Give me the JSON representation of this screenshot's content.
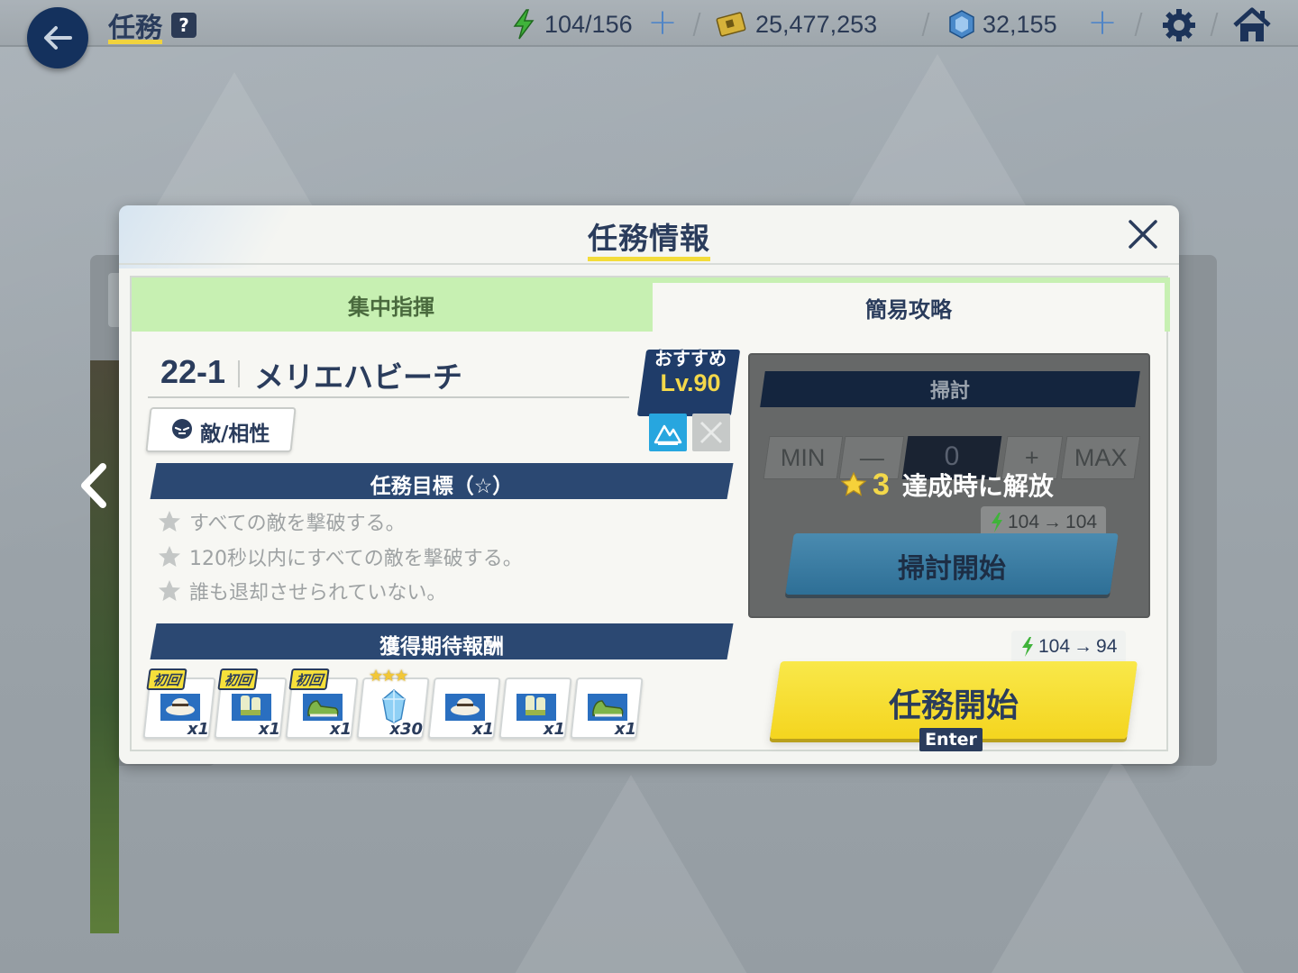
{
  "header": {
    "title": "任務",
    "help_label": "?",
    "stamina": "104/156",
    "credits": "25,477,253",
    "gems": "32,155"
  },
  "dialog": {
    "title": "任務情報",
    "tabs": [
      "集中指揮",
      "簡易攻略"
    ],
    "stage": {
      "code": "22-1",
      "name": "メリエハビーチ",
      "recommended_label": "おすすめ",
      "recommended_level": "Lv.90"
    },
    "enemy_button": "敵/相性",
    "objectives_header": "任務目標（☆）",
    "objectives": [
      "すべての敵を撃破する。",
      "120秒以内にすべての敵を撃破する。",
      "誰も退却させられていない。"
    ],
    "rewards_header": "獲得期待報酬",
    "rewards": [
      {
        "badge": "初回",
        "qty": "x1",
        "icon": "hat-icon"
      },
      {
        "badge": "初回",
        "qty": "x1",
        "icon": "gloves-icon"
      },
      {
        "badge": "初回",
        "qty": "x1",
        "icon": "shoes-icon"
      },
      {
        "badge": "★★★",
        "qty": "x30",
        "icon": "crystal-icon"
      },
      {
        "badge": "",
        "qty": "x1",
        "icon": "hat-icon"
      },
      {
        "badge": "",
        "qty": "x1",
        "icon": "gloves-icon"
      },
      {
        "badge": "",
        "qty": "x1",
        "icon": "shoes-icon"
      }
    ],
    "sweep": {
      "header": "掃討",
      "min_label": "MIN",
      "minus_label": "—",
      "count": "0",
      "plus_label": "+",
      "max_label": "MAX",
      "unlock_star_count": "3",
      "unlock_text": "達成時に解放",
      "cost_from": "104",
      "cost_to": "104",
      "start_label": "掃討開始"
    },
    "mission": {
      "cost_from": "104",
      "cost_to": "94",
      "start_label": "任務開始",
      "hotkey": "Enter"
    }
  },
  "colors": {
    "navy": "#2a3c5c",
    "accent_yellow": "#f4d51f",
    "tab_green": "#c7f0b2",
    "stamina_green": "#3fb33a"
  }
}
